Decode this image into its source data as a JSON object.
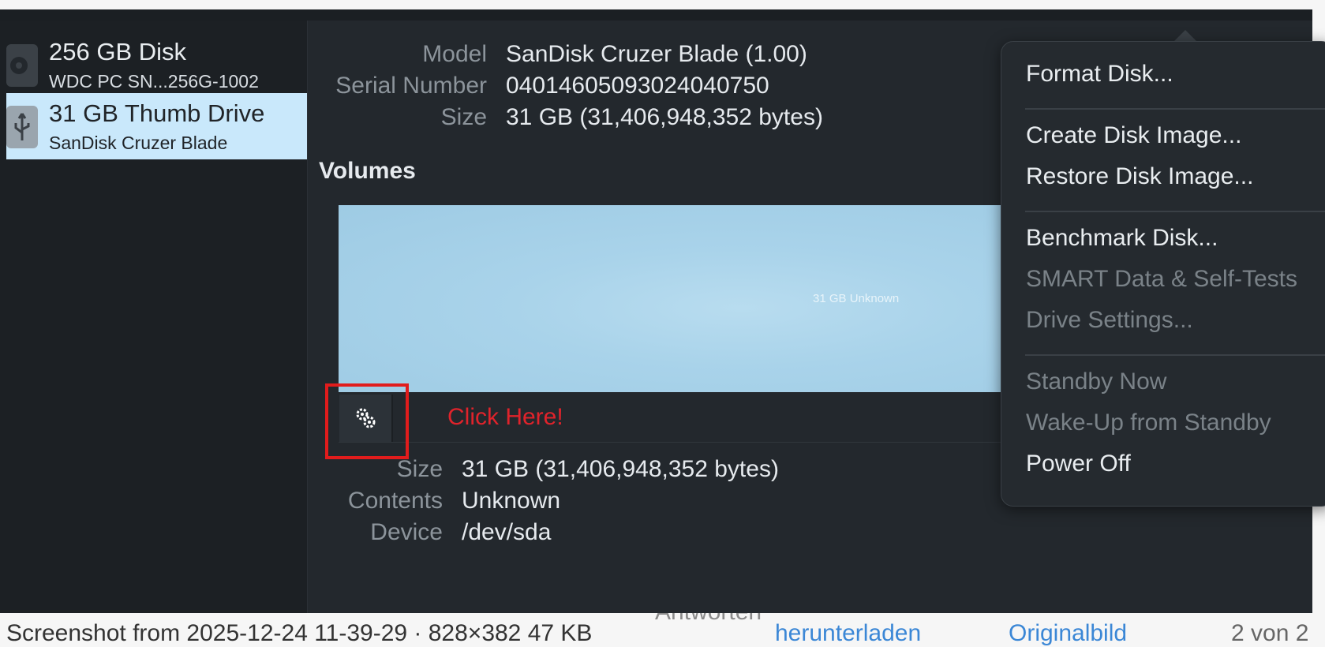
{
  "sidebar": {
    "disks": [
      {
        "title": "256 GB Disk",
        "subtitle": "WDC PC SN...256G-1002",
        "icon": "hard-disk-icon"
      },
      {
        "title": "31 GB Thumb Drive",
        "subtitle": "SanDisk Cruzer Blade",
        "icon": "usb-icon"
      }
    ]
  },
  "drive": {
    "model_label": "Model",
    "model": "SanDisk Cruzer Blade (1.00)",
    "serial_label": "Serial Number",
    "serial": "04014605093024040750",
    "size_label": "Size",
    "size": "31 GB (31,406,948,352 bytes)"
  },
  "volumes": {
    "heading": "Volumes",
    "bar_label": "31 GB Unknown",
    "size_label": "Size",
    "size": "31 GB (31,406,948,352 bytes)",
    "contents_label": "Contents",
    "contents": "Unknown",
    "device_label": "Device",
    "device": "/dev/sda"
  },
  "annotation": {
    "text": "Click Here!",
    "color": "#e0232b"
  },
  "menu": {
    "items": [
      {
        "label": "Format Disk...",
        "enabled": true
      },
      {
        "label": "Create Disk Image...",
        "enabled": true
      },
      {
        "label": "Restore Disk Image...",
        "enabled": true
      },
      {
        "label": "Benchmark Disk...",
        "enabled": true
      },
      {
        "label": "SMART Data & Self-Tests",
        "enabled": false
      },
      {
        "label": "Drive Settings...",
        "enabled": false
      },
      {
        "label": "Standby Now",
        "enabled": false
      },
      {
        "label": "Wake-Up from Standby",
        "enabled": false
      },
      {
        "label": "Power Off",
        "enabled": true
      }
    ]
  },
  "behind": {
    "toolbar_text": "Antworten",
    "caption_left": "Screenshot from 2025-12-24 11-39-29 · 828×382 47 KB",
    "download_link": "herunterladen",
    "original_link": "Originalbild",
    "page_counter": "2 von 2"
  },
  "colors": {
    "selection": "#c9e8fb",
    "volume_bar": "#a9d3ea",
    "window_bg": "#23282d",
    "link": "#3b87d6"
  }
}
